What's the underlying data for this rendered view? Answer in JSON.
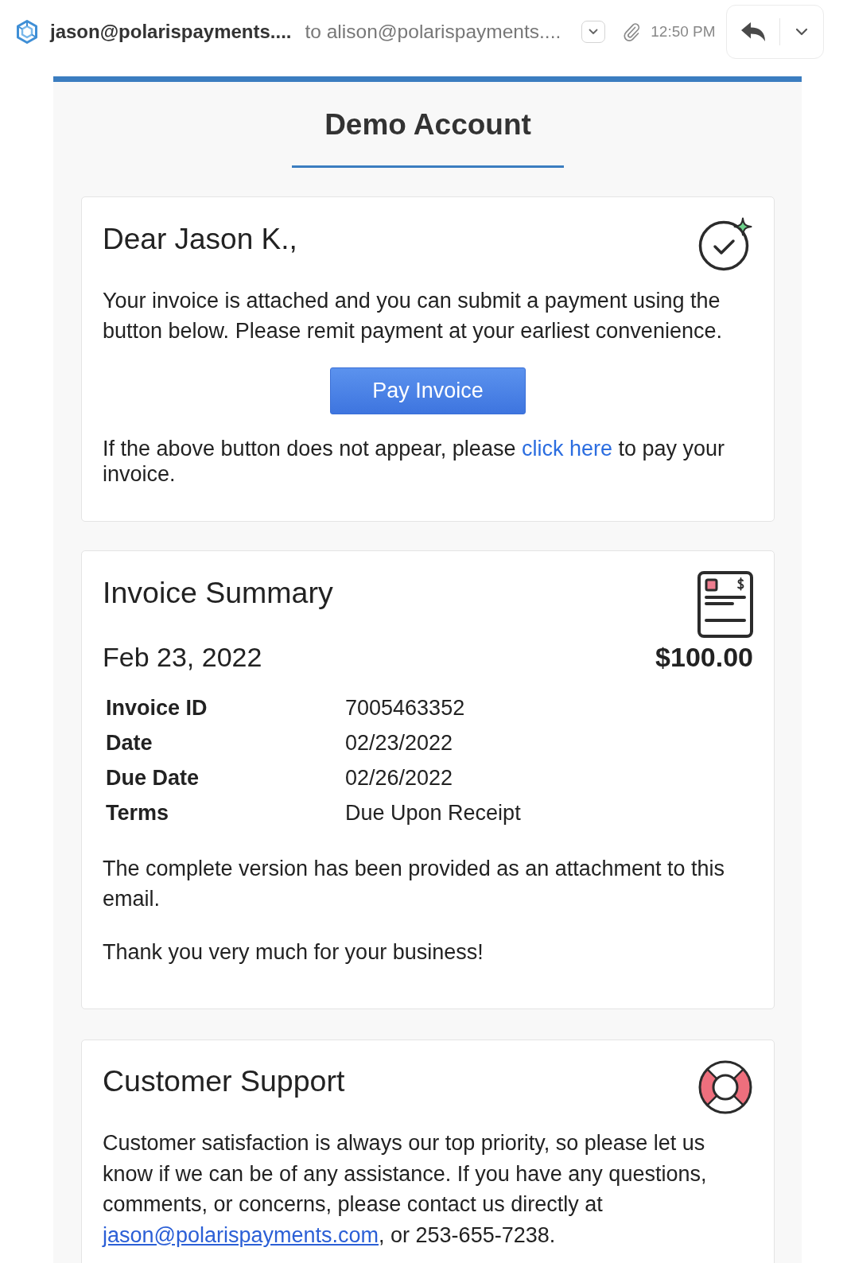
{
  "header": {
    "sender": "jason@polarispayments....",
    "recipient": "to alison@polarispayments....",
    "time": "12:50 PM"
  },
  "title": "Demo Account",
  "greeting_card": {
    "heading": "Dear Jason K.,",
    "message": "Your invoice is attached and you can submit a payment using the button below. Please remit payment at your earliest convenience.",
    "button": "Pay Invoice",
    "fallback": {
      "before": "If the above button does not appear, please ",
      "link": "click here",
      "after": " to pay your invoice."
    }
  },
  "invoice_card": {
    "heading": "Invoice Summary",
    "date": "Feb 23, 2022",
    "amount": "$100.00",
    "details": [
      {
        "label": "Invoice ID",
        "value": "7005463352"
      },
      {
        "label": "Date",
        "value": "02/23/2022"
      },
      {
        "label": "Due Date",
        "value": "02/26/2022"
      },
      {
        "label": "Terms",
        "value": "Due Upon Receipt"
      }
    ],
    "notes": [
      "The complete version has been provided as an attachment to this email.",
      "Thank you very much for your business!"
    ]
  },
  "support_card": {
    "heading": "Customer Support",
    "message": {
      "before": "Customer satisfaction is always our top priority, so please let us know if we can be of any assistance. If you have any questions, comments, or concerns, please contact us directly at ",
      "link": "jason@polarispayments.com",
      "after": ", or 253-655-7238."
    }
  }
}
